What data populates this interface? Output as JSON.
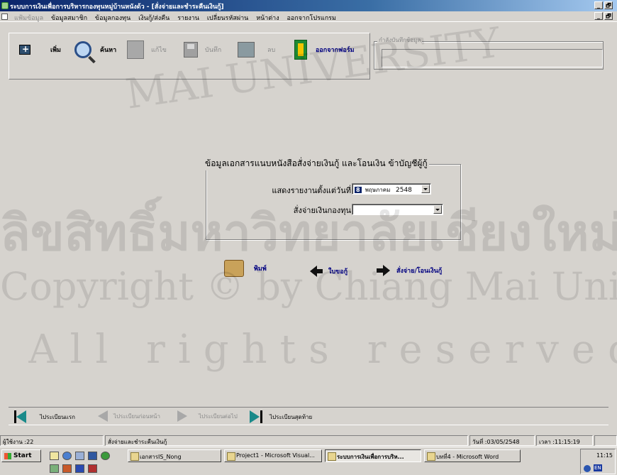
{
  "window": {
    "title": "ระบบการเงินเพื่อการบริหารกองทุนหมู่บ้านหนังด้ว - [สั่งจ่ายและชำระคืนเงินกู้]",
    "buttons": {
      "minimize": "_",
      "restore": "🗗"
    }
  },
  "menu": {
    "items": [
      {
        "label": "แฟ้มข้อมูล",
        "enabled": false
      },
      {
        "label": "ข้อมูลสมาชิก",
        "enabled": true
      },
      {
        "label": "ข้อมูลกองทุน",
        "enabled": true
      },
      {
        "label": "เงินกู้/ส่งคืน",
        "enabled": true
      },
      {
        "label": "รายงาน",
        "enabled": true
      },
      {
        "label": "เปลี่ยนรหัสผ่าน",
        "enabled": true
      },
      {
        "label": "หน้าต่าง",
        "enabled": true
      },
      {
        "label": "ออกจากโปรแกรม",
        "enabled": true
      }
    ]
  },
  "toolbar": {
    "add": "เพิ่ม",
    "search": "ค้นหา",
    "edit": "แก้ไข",
    "save": "บันทึก",
    "delete": "ลบ",
    "exit_form": "ออกจากฟอร์ม"
  },
  "status_group": {
    "legend": "กำลังบันทึกข้อมูล",
    "value": ""
  },
  "form": {
    "legend": "ข้อมูลเอกสารแนบหนังสือสั่งจ่ายเงินกู้ และโอนเงิน ข้าบัญชีผู้กู้",
    "report_from_label": "แสดงรายงานตั้งแต่วันที่",
    "report_from_day": "8",
    "report_from_month": "พฤษภาคม",
    "report_from_year": "2548",
    "fund_label": "สั่งจ่ายเงินกองทุน",
    "fund_value": ""
  },
  "actions": {
    "print": "พิมพ์",
    "loan_request": "ใบขอกู้",
    "pay_transfer": "สั่งจ่าย/โอนเงินกู้"
  },
  "record_nav": {
    "first": "ไประเบียนแรก",
    "prev": "ไประเบียนก่อนหน้า",
    "next": "ไประเบียนต่อไป",
    "last": "ไประเบียนสุดท้าย"
  },
  "app_status": {
    "user": "ผู้ใช้งาน :22",
    "form_name": "สั่งจ่ายและชำระคืนเงินกู้",
    "date": "วันที่ :03/05/2548",
    "time": "เวลา :11:15:19"
  },
  "taskbar": {
    "start": "Start",
    "tasks": [
      {
        "label": "เอกสารIS_Nong",
        "active": false
      },
      {
        "label": "Project1 - Microsoft Visual...",
        "active": false
      },
      {
        "label": "ระบบการเงินเพื่อการบริห...",
        "active": true
      },
      {
        "label": "บทที่4 - Microsoft Word",
        "active": false
      }
    ],
    "clock": "11:15",
    "lang": "EN"
  },
  "watermark": {
    "line1": "MAI UNIVERSITY",
    "line2": "ลิขสิทธิ์มหาวิทยาลัยเชียงใหม่",
    "line3": "Copyright © by Chiang Mai University",
    "line4": "All rights reserved"
  }
}
